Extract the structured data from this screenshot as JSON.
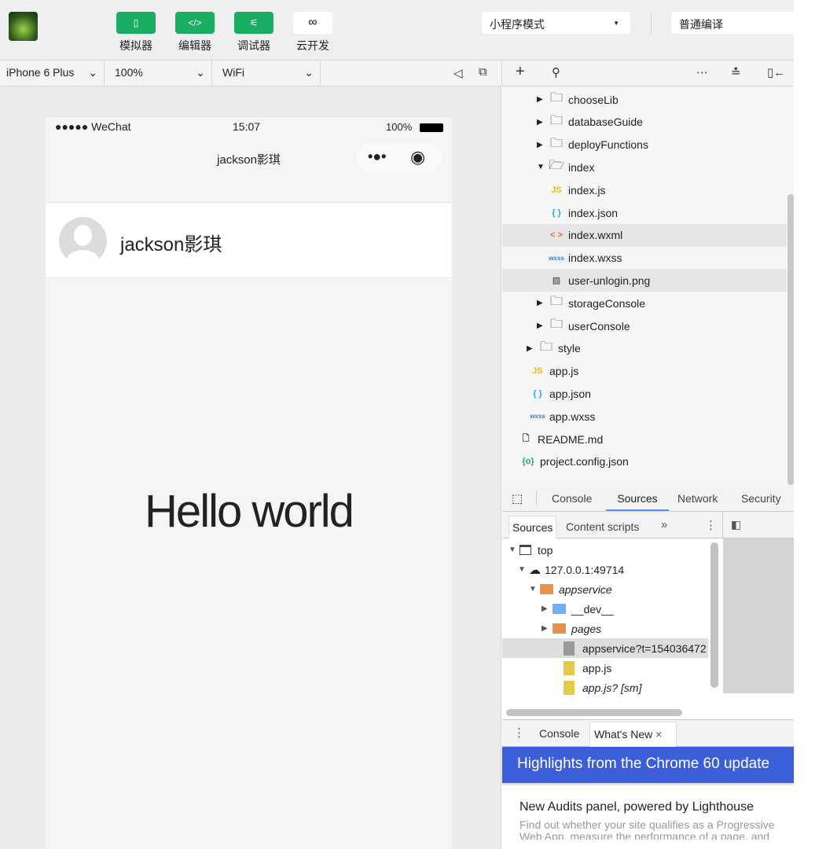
{
  "toolbar": {
    "buttons": [
      {
        "label": "模拟器",
        "icon": "phone-icon"
      },
      {
        "label": "编辑器",
        "icon": "code-icon"
      },
      {
        "label": "调试器",
        "icon": "debug-icon"
      },
      {
        "label": "云开发",
        "icon": "cloud-link-icon"
      }
    ],
    "mode_select": "小程序模式",
    "compile_select": "普通编译"
  },
  "sim_toolbar": {
    "device": "iPhone 6 Plus",
    "zoom": "100%",
    "network": "WiFi"
  },
  "phone": {
    "carrier": "●●●●● WeChat",
    "time": "15:07",
    "battery": "100%",
    "nav_title": "jackson影琪",
    "user_name": "jackson影琪",
    "content": "Hello world"
  },
  "tree": [
    {
      "name": "chooseLib",
      "type": "folder",
      "expanded": false
    },
    {
      "name": "databaseGuide",
      "type": "folder",
      "expanded": false
    },
    {
      "name": "deployFunctions",
      "type": "folder",
      "expanded": false
    },
    {
      "name": "index",
      "type": "folder",
      "expanded": true
    },
    {
      "name": "index.js",
      "type": "js"
    },
    {
      "name": "index.json",
      "type": "json"
    },
    {
      "name": "index.wxml",
      "type": "wxml",
      "selected": true
    },
    {
      "name": "index.wxss",
      "type": "wxss"
    },
    {
      "name": "user-unlogin.png",
      "type": "image",
      "hover": true
    },
    {
      "name": "storageConsole",
      "type": "folder",
      "expanded": false
    },
    {
      "name": "userConsole",
      "type": "folder",
      "expanded": false
    },
    {
      "name": "style",
      "type": "folder",
      "expanded": false
    },
    {
      "name": "app.js",
      "type": "js"
    },
    {
      "name": "app.json",
      "type": "json"
    },
    {
      "name": "app.wxss",
      "type": "wxss"
    },
    {
      "name": "README.md",
      "type": "file"
    },
    {
      "name": "project.config.json",
      "type": "config"
    }
  ],
  "devtools": {
    "tabs": [
      "Console",
      "Sources",
      "Network",
      "Security"
    ],
    "active_tab": "Sources",
    "subtabs": [
      "Sources",
      "Content scripts"
    ],
    "sources": [
      {
        "name": "top"
      },
      {
        "name": "127.0.0.1:49714"
      },
      {
        "name": "appservice"
      },
      {
        "name": "__dev__"
      },
      {
        "name": "pages"
      },
      {
        "name": "appservice?t=154036472"
      },
      {
        "name": "app.js"
      },
      {
        "name": "app.js? [sm]"
      }
    ],
    "drawer_tabs": [
      "Console",
      "What's New"
    ],
    "banner": "Highlights from the Chrome 60 update",
    "news_title": "New Audits panel, powered by Lighthouse",
    "news_body": "Find out whether your site qualifies as a Progressive Web App, measure the performance of a page, and discover best practices"
  },
  "colors": {
    "accent": "#1aad63",
    "banner": "#3c5fd9"
  }
}
